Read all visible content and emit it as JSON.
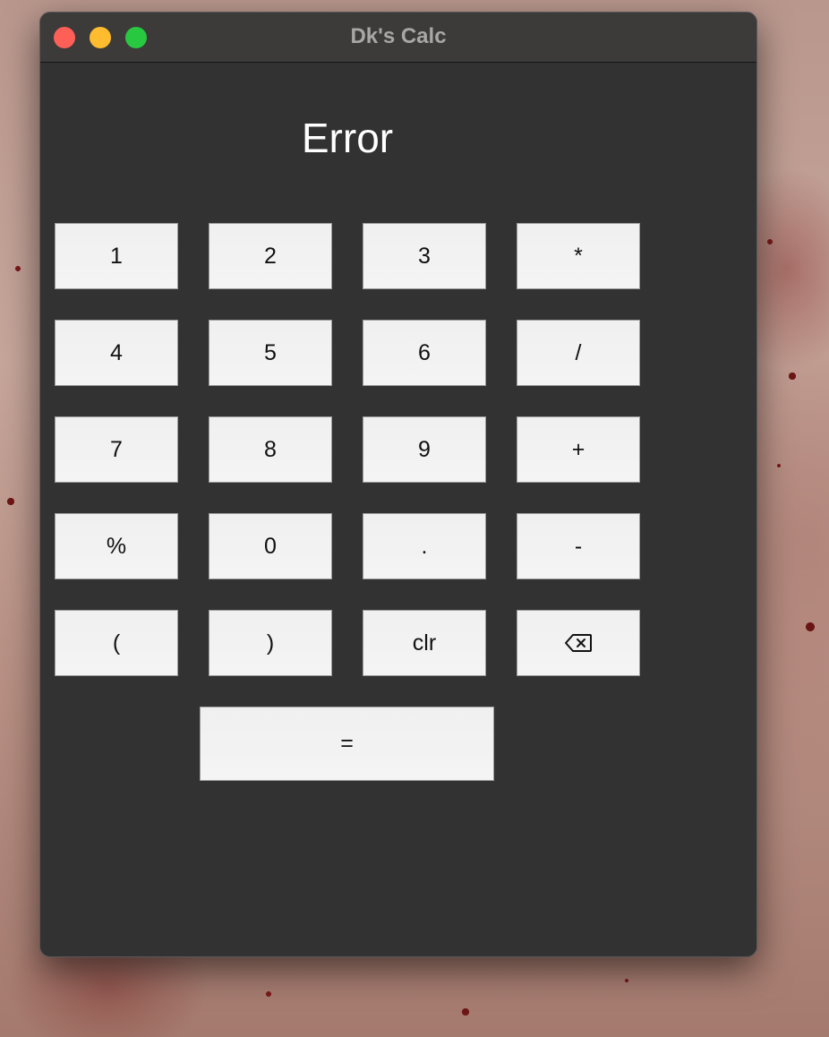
{
  "window": {
    "title": "Dk's Calc"
  },
  "display": {
    "value": "Error"
  },
  "keypad": {
    "row1": [
      "1",
      "2",
      "3",
      "*"
    ],
    "row2": [
      "4",
      "5",
      "6",
      "/"
    ],
    "row3": [
      "7",
      "8",
      "9",
      "+"
    ],
    "row4": [
      "%",
      "0",
      ".",
      "-"
    ],
    "row5": [
      "(",
      ")",
      "clr"
    ],
    "backspace_icon": "backspace-icon",
    "equals": "="
  },
  "colors": {
    "window_bg": "#323232",
    "titlebar_bg": "#3d3a3a",
    "close": "#fe5f57",
    "minimize": "#febc2e",
    "maximize": "#28c840",
    "key_bg": "#f2f2f2"
  }
}
